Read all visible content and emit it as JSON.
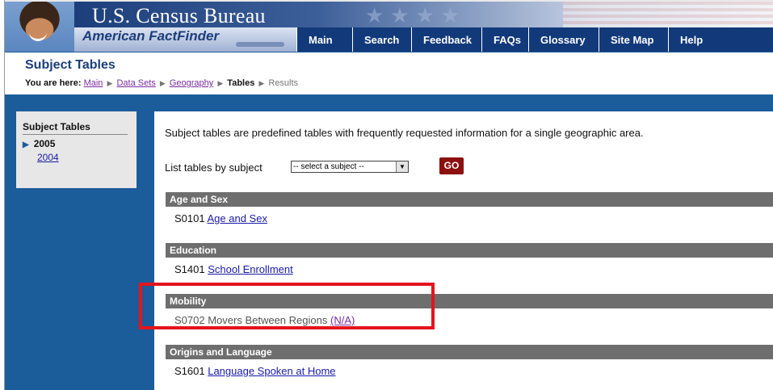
{
  "header": {
    "brand_title": "U.S. Census Bureau",
    "app_name": "American FactFinder",
    "nav": [
      "Main",
      "Search",
      "Feedback",
      "FAQs",
      "Glossary",
      "Site Map",
      "Help"
    ]
  },
  "page": {
    "title": "Subject Tables",
    "breadcrumb": {
      "prefix": "You are here:",
      "links": [
        "Main",
        "Data Sets",
        "Geography"
      ],
      "current": "Tables",
      "next": "Results"
    }
  },
  "sidebar": {
    "title": "Subject Tables",
    "years": [
      {
        "label": "2005",
        "selected": true
      },
      {
        "label": "2004",
        "selected": false
      }
    ]
  },
  "main": {
    "intro": "Subject tables are predefined tables with frequently requested information for a single geographic area.",
    "list_label": "List tables by subject",
    "select_value": "-- select a subject --",
    "go_label": "GO",
    "sections": [
      {
        "heading": "Age and Sex",
        "code": "S0101",
        "table": "Age and Sex"
      },
      {
        "heading": "Education",
        "code": "S1401",
        "table": "School Enrollment"
      },
      {
        "heading": "Mobility",
        "code": "S0702",
        "table": "Movers Between Regions",
        "na": "(N/A)"
      },
      {
        "heading": "Origins and Language",
        "code": "S1601",
        "table": "Language Spoken at Home"
      }
    ]
  },
  "colors": {
    "brand_blue": "#1b5c9a",
    "section_gray": "#6e6e6e",
    "go_red": "#8c1010",
    "highlight_red": "#e4141c"
  },
  "icons": [
    "breadcrumb-arrow-icon",
    "sidebar-selected-triangle-icon",
    "dropdown-arrow-icon"
  ]
}
